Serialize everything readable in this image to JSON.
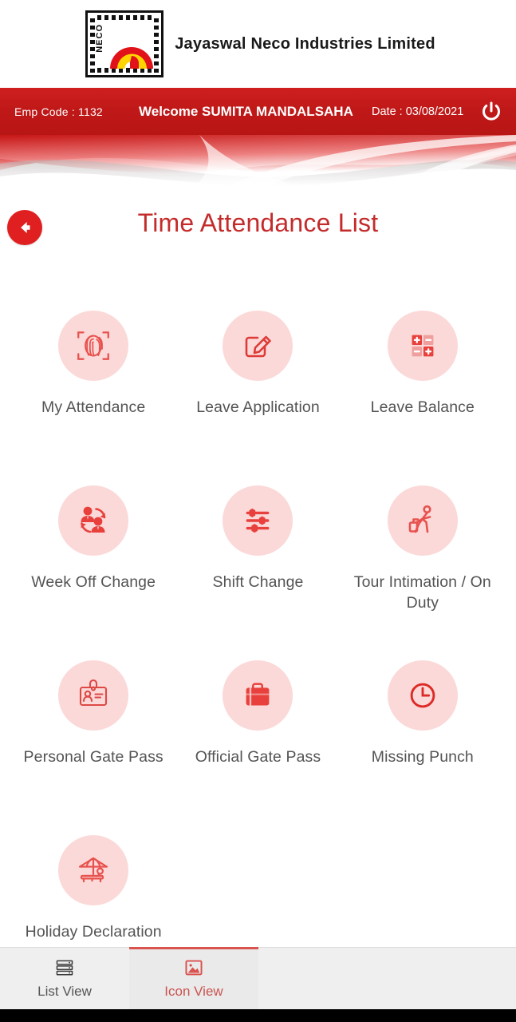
{
  "brand": {
    "logo_icon": "neco-logo",
    "logo_text": "NECO",
    "company_name": "Jayaswal Neco Industries Limited"
  },
  "infobar": {
    "emp_code": "Emp Code : 1132",
    "welcome": "Welcome SUMITA MANDALSAHA",
    "date": "Date : 03/08/2021",
    "power_icon": "power-icon",
    "background_color": "#c01818"
  },
  "header": {
    "back_icon": "arrow-left-circle-icon",
    "title": "Time Attendance List",
    "title_color": "#c42b2b"
  },
  "menu": {
    "tile_bg_color": "#fbd9d8",
    "tile_icon_color": "#e33b3b",
    "items": [
      {
        "label": "My Attendance",
        "icon": "fingerprint-scan-icon"
      },
      {
        "label": "Leave Application",
        "icon": "edit-pencil-icon"
      },
      {
        "label": "Leave Balance",
        "icon": "plus-minus-grid-icon"
      },
      {
        "label": "Week Off Change",
        "icon": "people-exchange-icon"
      },
      {
        "label": "Shift Change",
        "icon": "sliders-icon"
      },
      {
        "label": "Tour Intimation / On Duty",
        "icon": "traveler-luggage-icon"
      },
      {
        "label": "Personal Gate Pass",
        "icon": "id-badge-icon"
      },
      {
        "label": "Official Gate Pass",
        "icon": "briefcase-icon"
      },
      {
        "label": "Missing Punch",
        "icon": "clock-icon"
      },
      {
        "label": "Holiday Declaration",
        "icon": "beach-umbrella-icon"
      }
    ]
  },
  "tabs": {
    "active_color": "#c9534f",
    "items": [
      {
        "label": "List View",
        "icon": "list-rows-icon",
        "active": false
      },
      {
        "label": "Icon View",
        "icon": "image-picture-icon",
        "active": true
      }
    ]
  }
}
